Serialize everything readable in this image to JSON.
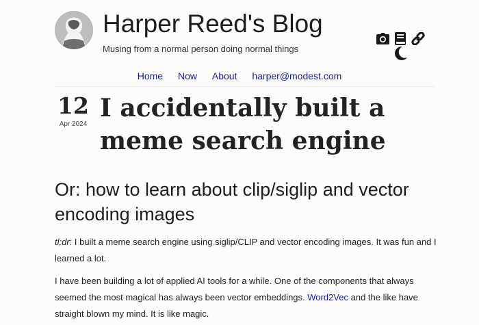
{
  "header": {
    "site_title": "Harper Reed's Blog",
    "tagline": "Musing from a normal person doing normal things",
    "icons": [
      "camera-icon",
      "book-icon",
      "link-icon",
      "moon-icon"
    ]
  },
  "nav": {
    "items": [
      {
        "label": "Home"
      },
      {
        "label": "Now"
      },
      {
        "label": "About"
      },
      {
        "label": "harper@modest.com"
      }
    ]
  },
  "post": {
    "day": "12",
    "month_year": "Apr 2024",
    "title": "I accidentally built a meme search engine",
    "subtitle": "Or: how to learn about clip/siglip and vector encoding images",
    "tldr_label": "tl;dr",
    "p1_rest": ": I built a meme search engine using siglip/CLIP and vector encoding images. It was fun and I learned a lot.",
    "p2_start": "I have been building a lot of applied AI tools for a while. One of the components that always seemed the most magical has always been vector embeddings. ",
    "p2_link": "Word2Vec",
    "p2_end": " and the like have straight blown my mind. It is like magic."
  },
  "colors": {
    "link": "#1a1aa6",
    "text": "#222222",
    "background": "#fcfcfc"
  }
}
